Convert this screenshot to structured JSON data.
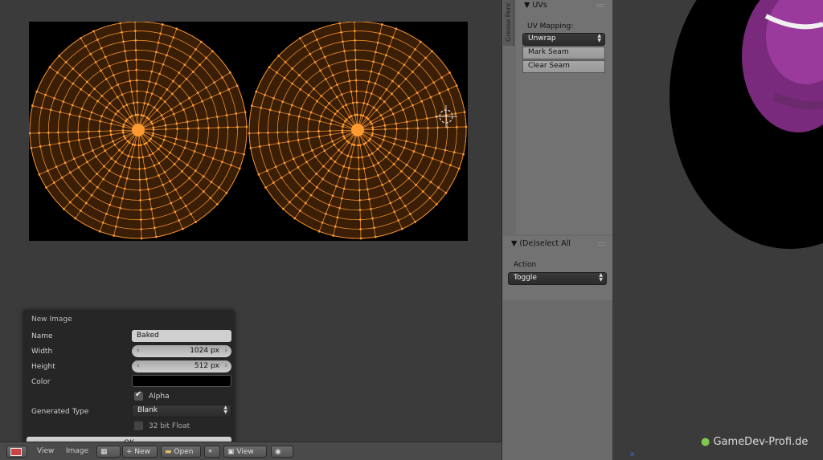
{
  "uv_panel": {
    "title": "UVs",
    "mapping_label": "UV Mapping:",
    "unwrap": "Unwrap",
    "mark_seam": "Mark Seam",
    "clear_seam": "Clear Seam"
  },
  "grease_tab": "Grease Penc",
  "deselect_panel": {
    "title": "(De)select All",
    "action_label": "Action",
    "action_value": "Toggle"
  },
  "popup": {
    "title": "New Image",
    "name_label": "Name",
    "name_value": "Baked",
    "width_label": "Width",
    "width_value": "1024 px",
    "height_label": "Height",
    "height_value": "512 px",
    "color_label": "Color",
    "alpha_label": "Alpha",
    "alpha_checked": true,
    "generated_type_label": "Generated Type",
    "generated_type_value": "Blank",
    "float_label": "32 bit Float",
    "float_checked": false,
    "ok_label": "OK"
  },
  "header": {
    "view_menu": "View",
    "image_menu": "Image",
    "new_button": "New",
    "open_button": "Open",
    "view_button": "View"
  },
  "watermark": "GameDev-Profi.de",
  "colors": {
    "uv_face": "#3a1e06",
    "uv_edge": "#e88a2e",
    "uv_vertex": "#ff9a30",
    "sphere_purple": "#8a2a8c"
  }
}
